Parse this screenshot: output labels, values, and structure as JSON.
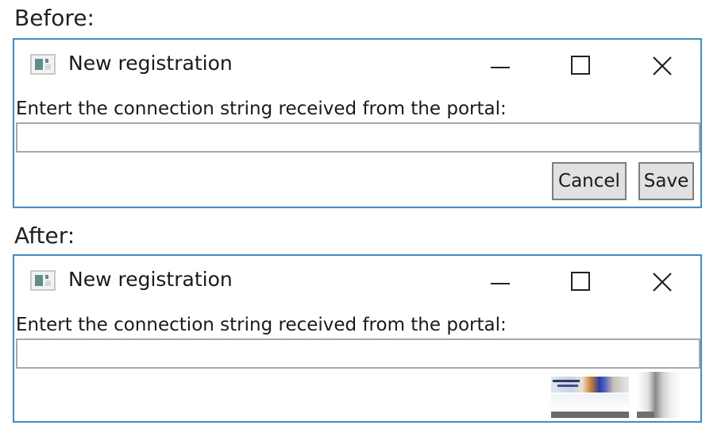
{
  "before": {
    "label": "Before:",
    "window": {
      "title": "New registration",
      "prompt": "Entert the connection string received from the portal:",
      "input_value": "",
      "cancel_label": "Cancel",
      "save_label": "Save"
    }
  },
  "after": {
    "label": "After:",
    "window": {
      "title": "New registration",
      "prompt": "Entert the connection string received from the portal:",
      "input_value": ""
    }
  },
  "colors": {
    "window_border": "#3c8ed6",
    "button_face": "#e1e1e1",
    "button_border": "#7e7e7e"
  },
  "icons": [
    "app-window-icon",
    "minimize-icon",
    "maximize-icon",
    "close-icon"
  ]
}
